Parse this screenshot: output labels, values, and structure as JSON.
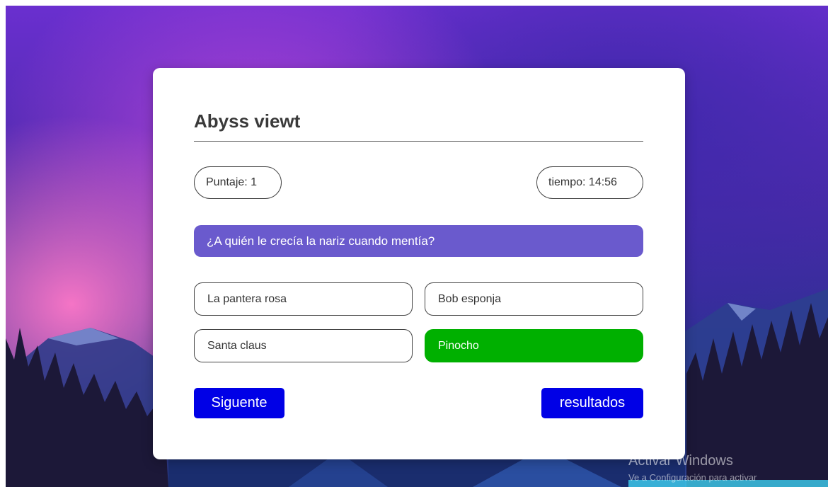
{
  "quiz": {
    "title": "Abyss viewt",
    "score_label": "Puntaje: 1",
    "timer_label": "tiempo: 14:56",
    "question": "¿A quién le crecía la nariz cuando mentía?",
    "answers": [
      {
        "label": "La pantera rosa",
        "state": "default"
      },
      {
        "label": "Bob esponja",
        "state": "default"
      },
      {
        "label": "Santa claus",
        "state": "default"
      },
      {
        "label": "Pinocho",
        "state": "correct"
      }
    ],
    "next_label": "Siguente",
    "results_label": "resultados"
  },
  "watermark": {
    "line1": "Activar Windows",
    "line2": "Ve a Configuración para activar"
  },
  "colors": {
    "question_bg": "#6a5acd",
    "correct_bg": "#00b000",
    "button_bg": "#0000e6"
  }
}
